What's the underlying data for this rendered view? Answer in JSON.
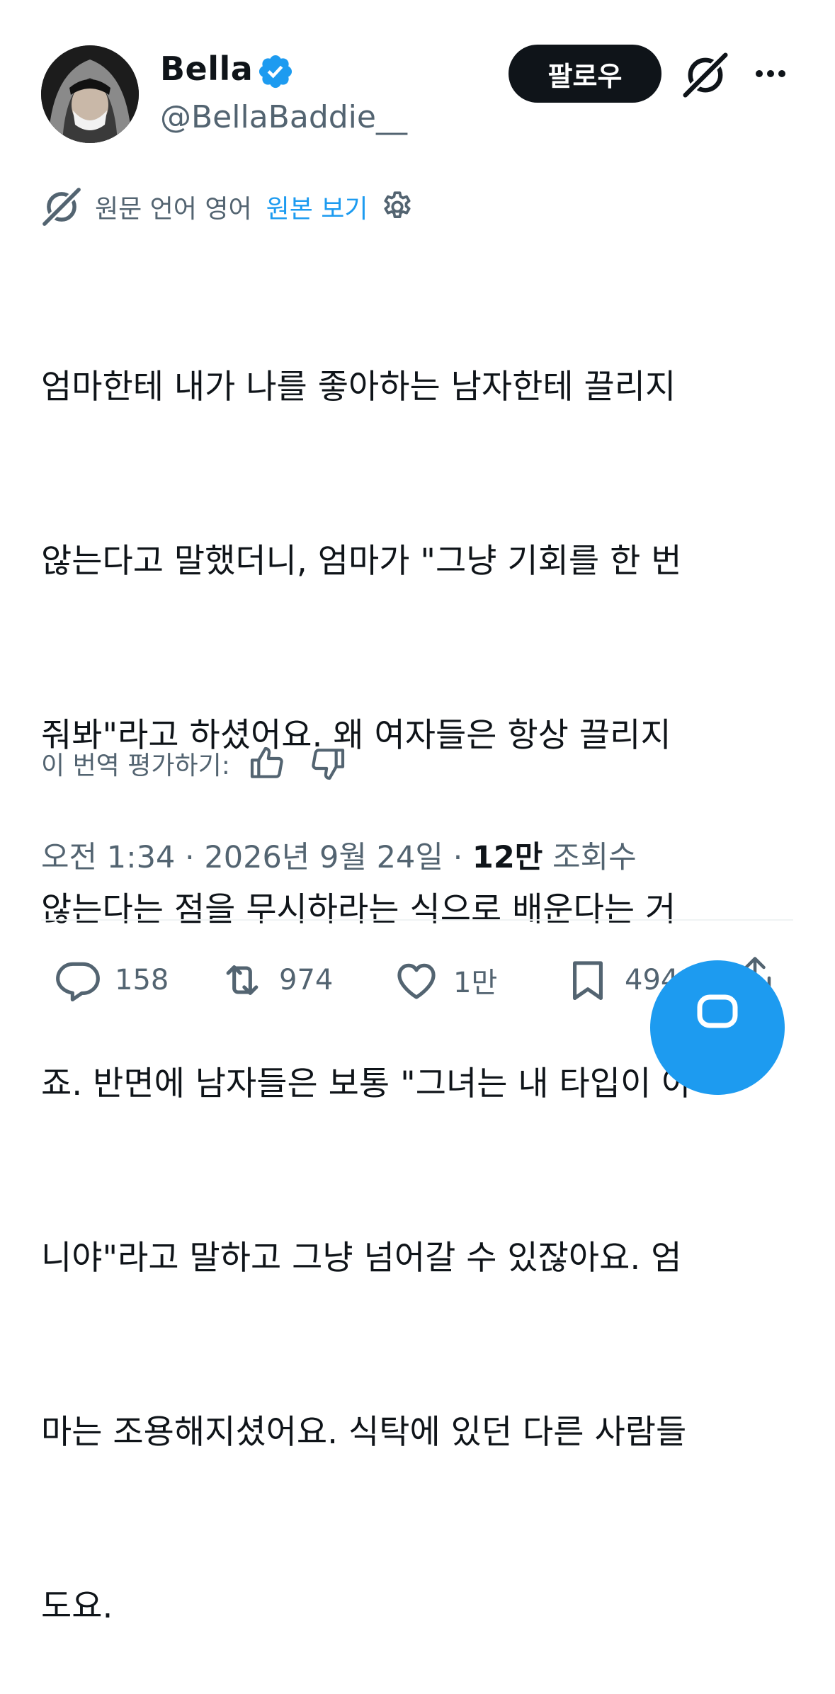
{
  "header": {
    "display_name": "Bella",
    "handle": "@BellaBaddie__",
    "follow_label": "팔로우"
  },
  "translation": {
    "label": "원문 언어 영어",
    "view_original": "원본 보기"
  },
  "tweet": {
    "lines": [
      "엄마한테 내가 나를 좋아하는 남자한테 끌리지",
      "않는다고 말했더니, 엄마가 \"그냥 기회를 한 번",
      "줘봐\"라고 하셨어요. 왜 여자들은 항상 끌리지",
      "않는다는 점을 무시하라는 식으로 배운다는 거",
      "죠. 반면에 남자들은 보통 \"그녀는 내 타입이 아",
      "니야\"라고 말하고 그냥 넘어갈 수 있잖아요. 엄",
      "마는 조용해지셨어요. 식탁에 있던 다른 사람들",
      "도요."
    ]
  },
  "rating": {
    "label": "이 번역 평가하기:"
  },
  "meta": {
    "time": "오전 1:34",
    "date": "2026년 9월 24일",
    "views_count": "12만",
    "views_label": "조회수"
  },
  "actions": {
    "replies": "158",
    "retweets": "974",
    "likes": "1만",
    "bookmarks": "494"
  },
  "colors": {
    "accent": "#1d9bf0",
    "secondary_text": "#536471",
    "primary_text": "#0f1419"
  },
  "icons": [
    "verified-badge-icon",
    "grok-icon",
    "more-icon",
    "gear-icon",
    "thumbs-up-icon",
    "thumbs-down-icon",
    "reply-icon",
    "retweet-icon",
    "like-icon",
    "bookmark-icon",
    "share-icon"
  ]
}
